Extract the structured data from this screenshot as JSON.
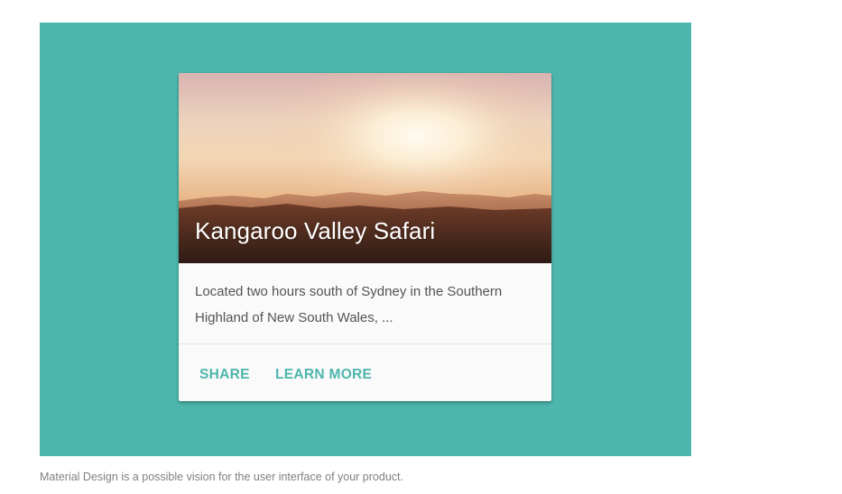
{
  "card": {
    "title": "Kangaroo Valley Safari",
    "text": "Located two hours south of Sydney in the Southern Highland of New South Wales, ...",
    "actions": {
      "share_label": "SHARE",
      "learn_more_label": "LEARN MORE"
    }
  },
  "caption": "Material Design is a possible vision for the user interface of your product.",
  "colors": {
    "stage_background": "#4db6ac",
    "accent": "#4db6ac",
    "card_background": "#fafafa",
    "caption_text": "#808080"
  }
}
